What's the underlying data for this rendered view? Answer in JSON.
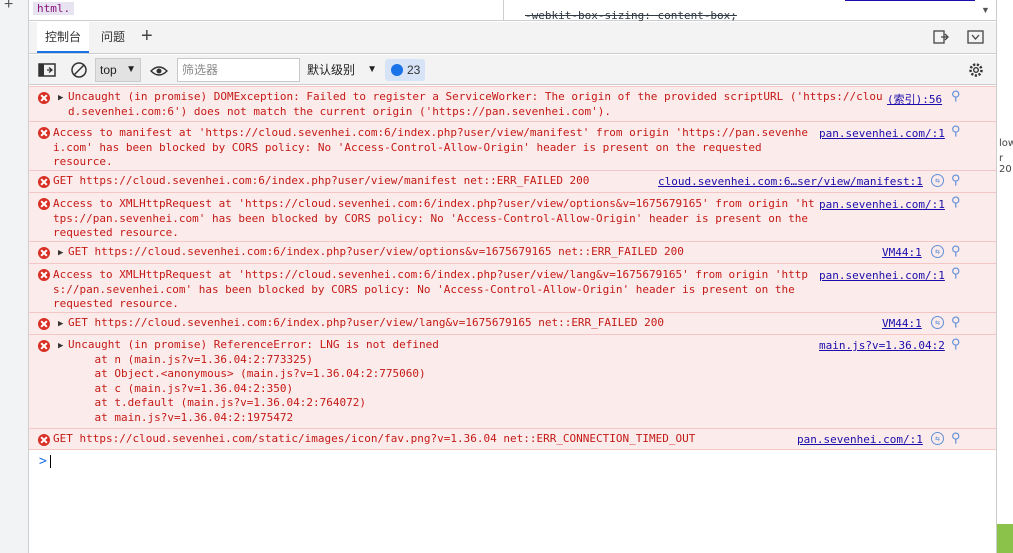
{
  "top": {
    "html_tag": "html.",
    "css_text": "-webkit-box-sizing: content-box;"
  },
  "tabs": [
    {
      "label": "控制台",
      "active": true
    },
    {
      "label": "问题",
      "active": false
    }
  ],
  "toolbar": {
    "context": "top",
    "filter_placeholder": "筛选器",
    "levels": "默认级别",
    "issues_count": "23"
  },
  "log": [
    {
      "lines": [
        "Uncaught (in promise) DOMException: Failed to register a ServiceWorker: The origin of the provided scriptURL ('https://clou",
        "d.sevenhei.com:6') does not match the current origin ('https://pan.sevenhei.com')."
      ],
      "source": "(索引):56",
      "expandable": true,
      "translate": false
    },
    {
      "lines": [
        "Access to manifest at 'https://cloud.sevenhei.com:6/index.php?user/view/manifest' from origin 'https://pan.sevenhe",
        "i.com' has been blocked by CORS policy: No 'Access-Control-Allow-Origin' header is present on the requested",
        "resource."
      ],
      "source": "pan.sevenhei.com/:1",
      "expandable": false,
      "translate": false
    },
    {
      "lines": [
        "GET https://cloud.sevenhei.com:6/index.php?user/view/manifest net::ERR_FAILED 200"
      ],
      "source": "cloud.sevenhei.com:6…ser/view/manifest:1",
      "expandable": false,
      "translate": true
    },
    {
      "lines": [
        "Access to XMLHttpRequest at 'https://cloud.sevenhei.com:6/index.php?user/view/options&v=1675679165' from origin 'ht",
        "tps://pan.sevenhei.com' has been blocked by CORS policy: No 'Access-Control-Allow-Origin' header is present on the",
        "requested resource."
      ],
      "source": "pan.sevenhei.com/:1",
      "expandable": false,
      "translate": false
    },
    {
      "lines": [
        "GET https://cloud.sevenhei.com:6/index.php?user/view/options&v=1675679165 net::ERR_FAILED 200"
      ],
      "source": "VM44:1",
      "expandable": true,
      "translate": true
    },
    {
      "lines": [
        "Access to XMLHttpRequest at 'https://cloud.sevenhei.com:6/index.php?user/view/lang&v=1675679165' from origin 'http",
        "s://pan.sevenhei.com' has been blocked by CORS policy: No 'Access-Control-Allow-Origin' header is present on the",
        "requested resource."
      ],
      "source": "pan.sevenhei.com/:1",
      "expandable": false,
      "translate": false
    },
    {
      "lines": [
        "GET https://cloud.sevenhei.com:6/index.php?user/view/lang&v=1675679165 net::ERR_FAILED 200"
      ],
      "source": "VM44:1",
      "expandable": true,
      "translate": true
    },
    {
      "lines": [
        "Uncaught (in promise) ReferenceError: LNG is not defined",
        "    at n (main.js?v=1.36.04:2:773325)",
        "    at Object.<anonymous> (main.js?v=1.36.04:2:775060)",
        "    at c (main.js?v=1.36.04:2:350)",
        "    at t.default (main.js?v=1.36.04:2:764072)",
        "    at main.js?v=1.36.04:2:1975472"
      ],
      "source": "main.js?v=1.36.04:2",
      "expandable": true,
      "translate": false
    },
    {
      "lines": [
        "GET https://cloud.sevenhei.com/static/images/icon/fav.png?v=1.36.04 net::ERR_CONNECTION_TIMED_OUT"
      ],
      "source": "pan.sevenhei.com/:1",
      "expandable": false,
      "translate": true
    }
  ],
  "prompt": ">"
}
